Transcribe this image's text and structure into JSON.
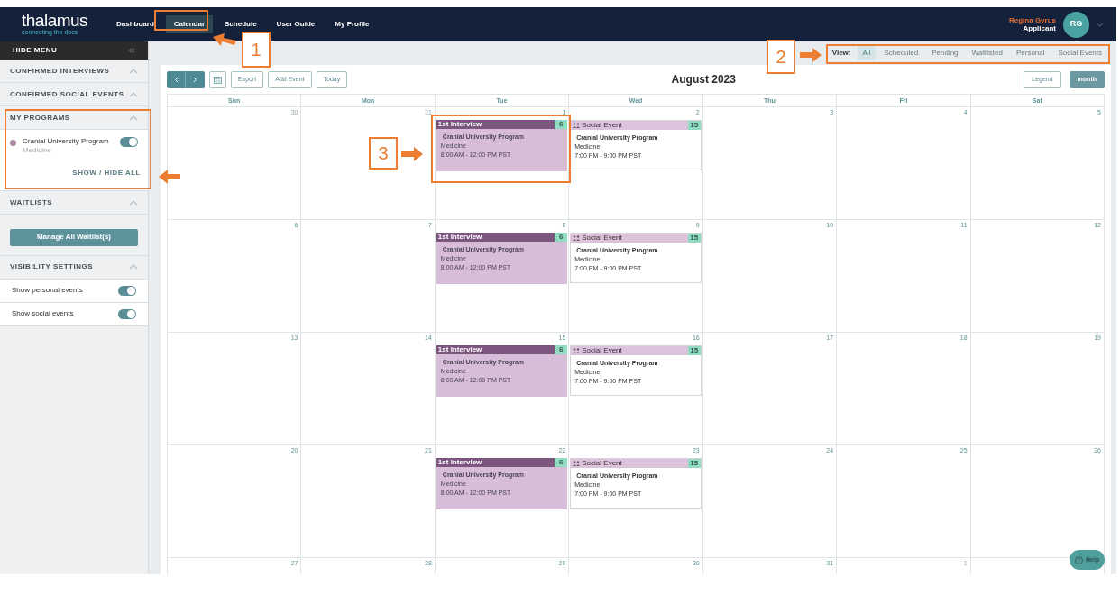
{
  "nav": {
    "logo": "thalamus",
    "tagline": "connecting the docs",
    "items": [
      {
        "label": "Dashboard",
        "selected": false
      },
      {
        "label": "Calendar",
        "selected": true
      },
      {
        "label": "Schedule",
        "selected": false
      },
      {
        "label": "User Guide",
        "selected": false
      },
      {
        "label": "My Profile",
        "selected": false
      }
    ],
    "user": {
      "name": "Regina Gyrus",
      "role": "Applicant",
      "initials": "RG"
    }
  },
  "sidebar": {
    "hide_menu": "HIDE MENU",
    "sections": [
      {
        "kind": "empty",
        "title": "CONFIRMED INTERVIEWS",
        "expanded": true
      },
      {
        "kind": "empty",
        "title": "CONFIRMED SOCIAL EVENTS",
        "expanded": true
      },
      {
        "kind": "programs",
        "title": "MY PROGRAMS",
        "expanded": true,
        "programs": [
          {
            "name": "Cranial University Program",
            "specialty": "Medicine",
            "color": "#a98aa5",
            "on": true
          }
        ],
        "link": "SHOW / HIDE ALL"
      },
      {
        "kind": "button",
        "title": "WAITLISTS",
        "expanded": true,
        "button": "Manage All Waitlist(s)"
      },
      {
        "kind": "toggles",
        "title": "VISIBILITY SETTINGS",
        "expanded": true,
        "toggles": [
          {
            "label": "Show personal events",
            "on": true
          },
          {
            "label": "Show social events",
            "on": true
          }
        ]
      }
    ]
  },
  "view_filter": {
    "label": "View:",
    "options": [
      {
        "label": "All",
        "selected": true
      },
      {
        "label": "Scheduled",
        "selected": false
      },
      {
        "label": "Pending",
        "selected": false
      },
      {
        "label": "Waitlisted",
        "selected": false
      },
      {
        "label": "Personal",
        "selected": false
      },
      {
        "label": "Social Events",
        "selected": false
      }
    ]
  },
  "calendar": {
    "title": "August 2023",
    "toolbar": [
      "Export",
      "Add Event",
      "Today"
    ],
    "legend": "Legend",
    "views": [
      {
        "label": "month",
        "selected": true
      }
    ],
    "weekdays": [
      "Sun",
      "Mon",
      "Tue",
      "Wed",
      "Thu",
      "Fri",
      "Sat"
    ],
    "weeks": [
      [
        {
          "day": "30",
          "in_month": false
        },
        {
          "day": "31",
          "in_month": false
        },
        {
          "day": "1",
          "in_month": true,
          "events": [
            {
              "kind": "interview",
              "title": "1st Interview",
              "badge": "6",
              "program": "Cranial University Program",
              "specialty": "Medicine",
              "time": "8:00 AM - 12:00 PM PST"
            }
          ]
        },
        {
          "day": "2",
          "in_month": true,
          "events": [
            {
              "kind": "social",
              "title": "Social Event",
              "badge": "15",
              "program": "Cranial University Program",
              "specialty": "Medicine",
              "time": "7:00 PM - 9:00 PM PST"
            }
          ]
        },
        {
          "day": "3",
          "in_month": true
        },
        {
          "day": "4",
          "in_month": true
        },
        {
          "day": "5",
          "in_month": true
        }
      ],
      [
        {
          "day": "6",
          "in_month": true
        },
        {
          "day": "7",
          "in_month": true
        },
        {
          "day": "8",
          "in_month": true,
          "events": [
            {
              "kind": "interview",
              "title": "1st Interview",
              "badge": "6",
              "program": "Cranial University Program",
              "specialty": "Medicine",
              "time": "8:00 AM - 12:00 PM PST"
            }
          ]
        },
        {
          "day": "9",
          "in_month": true,
          "events": [
            {
              "kind": "social",
              "title": "Social Event",
              "badge": "15",
              "program": "Cranial University Program",
              "specialty": "Medicine",
              "time": "7:00 PM - 9:00 PM PST"
            }
          ]
        },
        {
          "day": "10",
          "in_month": true
        },
        {
          "day": "11",
          "in_month": true
        },
        {
          "day": "12",
          "in_month": true
        }
      ],
      [
        {
          "day": "13",
          "in_month": true
        },
        {
          "day": "14",
          "in_month": true
        },
        {
          "day": "15",
          "in_month": true,
          "events": [
            {
              "kind": "interview",
              "title": "1st Interview",
              "badge": "6",
              "program": "Cranial University Program",
              "specialty": "Medicine",
              "time": "8:00 AM - 12:00 PM PST"
            }
          ]
        },
        {
          "day": "16",
          "in_month": true,
          "events": [
            {
              "kind": "social",
              "title": "Social Event",
              "badge": "15",
              "program": "Cranial University Program",
              "specialty": "Medicine",
              "time": "7:00 PM - 9:00 PM PST"
            }
          ]
        },
        {
          "day": "17",
          "in_month": true
        },
        {
          "day": "18",
          "in_month": true
        },
        {
          "day": "19",
          "in_month": true
        }
      ],
      [
        {
          "day": "20",
          "in_month": true
        },
        {
          "day": "21",
          "in_month": true
        },
        {
          "day": "22",
          "in_month": true,
          "events": [
            {
              "kind": "interview",
              "title": "1st Interview",
              "badge": "6",
              "program": "Cranial University Program",
              "specialty": "Medicine",
              "time": "8:00 AM - 12:00 PM PST"
            }
          ]
        },
        {
          "day": "23",
          "in_month": true,
          "events": [
            {
              "kind": "social",
              "title": "Social Event",
              "badge": "15",
              "program": "Cranial University Program",
              "specialty": "Medicine",
              "time": "7:00 PM - 9:00 PM PST"
            }
          ]
        },
        {
          "day": "24",
          "in_month": true
        },
        {
          "day": "25",
          "in_month": true
        },
        {
          "day": "26",
          "in_month": true
        }
      ],
      [
        {
          "day": "27",
          "in_month": true
        },
        {
          "day": "28",
          "in_month": true
        },
        {
          "day": "29",
          "in_month": true
        },
        {
          "day": "30",
          "in_month": true
        },
        {
          "day": "31",
          "in_month": true
        },
        {
          "day": "1",
          "in_month": false
        }
      ]
    ]
  },
  "help": "Help",
  "annotations": [
    {
      "kind": "numbered",
      "label": "1"
    },
    {
      "kind": "numbered",
      "label": "2"
    },
    {
      "kind": "numbered",
      "label": "3"
    },
    {
      "kind": "frame"
    }
  ]
}
